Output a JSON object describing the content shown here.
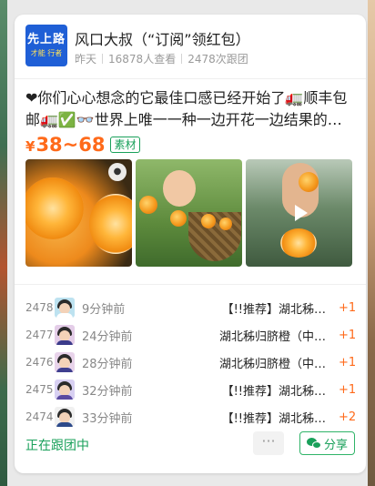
{
  "group": {
    "logo_line1": "先上路",
    "logo_line2": "才能 行者",
    "title": "风口大叔（“订阅”领红包）",
    "meta": [
      "昨天",
      "16878人查看",
      "2478次跟团"
    ]
  },
  "post": {
    "description": "❤你们心心想念的它最佳口感已经开始了🚛顺丰包邮🚛✅👓世界上唯一一种一边开花一边结果的…",
    "price_prefix": "¥",
    "price_range": "38~68",
    "tag": "素材"
  },
  "media": [
    {
      "kind": "image",
      "badge": "logo"
    },
    {
      "kind": "image"
    },
    {
      "kind": "video"
    }
  ],
  "orders": [
    {
      "num": "2478",
      "time": "9分钟前",
      "item": "【!!推荐】湖北秭…",
      "qty": "+1"
    },
    {
      "num": "2477",
      "time": "24分钟前",
      "item": "湖北秭归脐橙（中…",
      "qty": "+1"
    },
    {
      "num": "2476",
      "time": "28分钟前",
      "item": "湖北秭归脐橙（中…",
      "qty": "+1"
    },
    {
      "num": "2475",
      "time": "32分钟前",
      "item": "【!!推荐】湖北秭…",
      "qty": "+1"
    },
    {
      "num": "2474",
      "time": "33分钟前",
      "item": "【!!推荐】湖北秭…",
      "qty": "+2"
    }
  ],
  "footer": {
    "status": "正在跟团中",
    "more": "···",
    "share": "分享"
  },
  "colors": {
    "accent_green": "#19a05a",
    "price_orange": "#ff6a1a",
    "logo_blue": "#1f5fd6"
  }
}
